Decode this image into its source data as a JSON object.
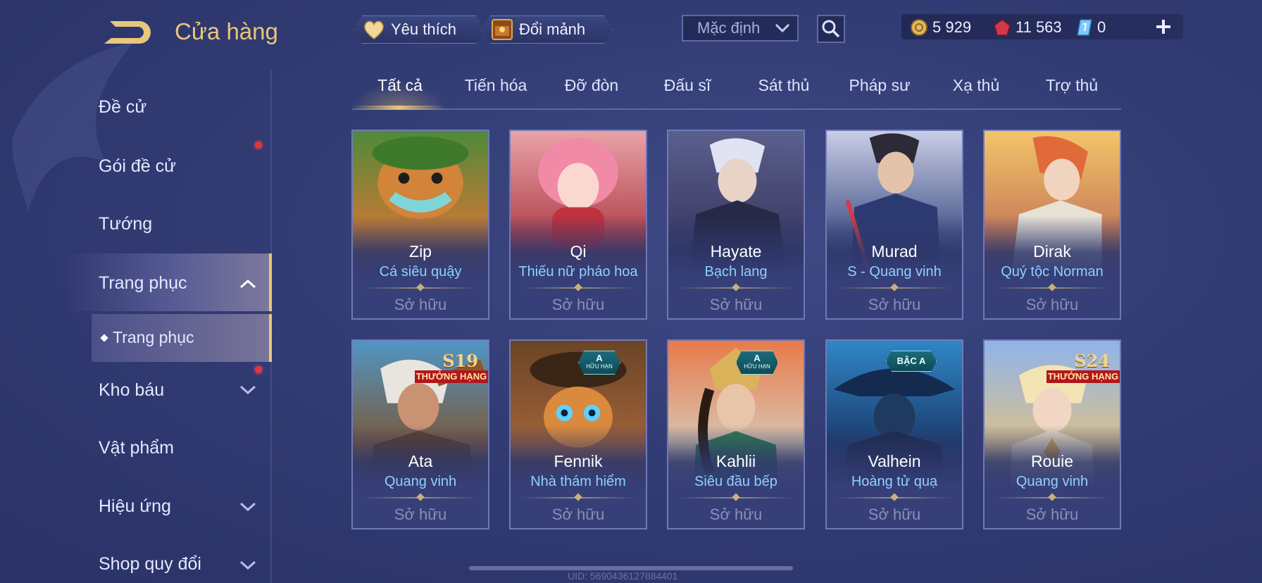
{
  "header": {
    "title": "Cửa hàng",
    "favorites_label": "Yêu thích",
    "shard_exchange_label": "Đổi mảnh",
    "sort_value": "Mặc định"
  },
  "currencies": {
    "gold": "5 929",
    "ruby": "11 563",
    "ticket": "0"
  },
  "sidebar": {
    "items": [
      {
        "label": "Đề cử"
      },
      {
        "label": "Gói đề cử"
      },
      {
        "label": "Tướng"
      },
      {
        "label": "Trang phục"
      },
      {
        "label": "Trang phục"
      },
      {
        "label": "Kho báu"
      },
      {
        "label": "Vật phẩm"
      },
      {
        "label": "Hiệu ứng"
      },
      {
        "label": "Shop quy đổi"
      }
    ]
  },
  "tabs": [
    "Tất cả",
    "Tiến hóa",
    "Đỡ đòn",
    "Đấu sĩ",
    "Sát thủ",
    "Pháp sư",
    "Xạ thủ",
    "Trợ thủ"
  ],
  "cards": [
    {
      "hero": "Zip",
      "skin": "Cá siêu quậy",
      "status": "Sở hữu"
    },
    {
      "hero": "Qi",
      "skin": "Thiếu nữ pháo hoa",
      "status": "Sở hữu"
    },
    {
      "hero": "Hayate",
      "skin": "Bạch lang",
      "status": "Sở hữu"
    },
    {
      "hero": "Murad",
      "skin": "S - Quang vinh",
      "status": "Sở hữu"
    },
    {
      "hero": "Dirak",
      "skin": "Quý tộc Norman",
      "status": "Sở hữu"
    },
    {
      "hero": "Ata",
      "skin": "Quang vinh",
      "status": "Sở hữu",
      "badge_top": "S19",
      "badge_bottom": "THƯỞNG HẠNG"
    },
    {
      "hero": "Fennik",
      "skin": "Nhà thám hiểm",
      "status": "Sở hữu",
      "badge_top": "A",
      "badge_bottom": "HỮU HẠN"
    },
    {
      "hero": "Kahlii",
      "skin": "Siêu đầu bếp",
      "status": "Sở hữu",
      "badge_top": "A",
      "badge_bottom": "HỮU HẠN"
    },
    {
      "hero": "Valhein",
      "skin": "Hoàng tử quạ",
      "status": "Sở hữu",
      "badge_top": "BẬC A"
    },
    {
      "hero": "Rouie",
      "skin": "Quang vinh",
      "status": "Sở hữu",
      "badge_top": "S24",
      "badge_bottom": "THƯỞNG HẠNG"
    }
  ],
  "footer": {
    "uid": "UID: 5690436127884401"
  },
  "colors": {
    "accent_gold": "#e8c77a",
    "skin_name_blue": "#8fd0ff",
    "notification_red": "#e5343a"
  }
}
